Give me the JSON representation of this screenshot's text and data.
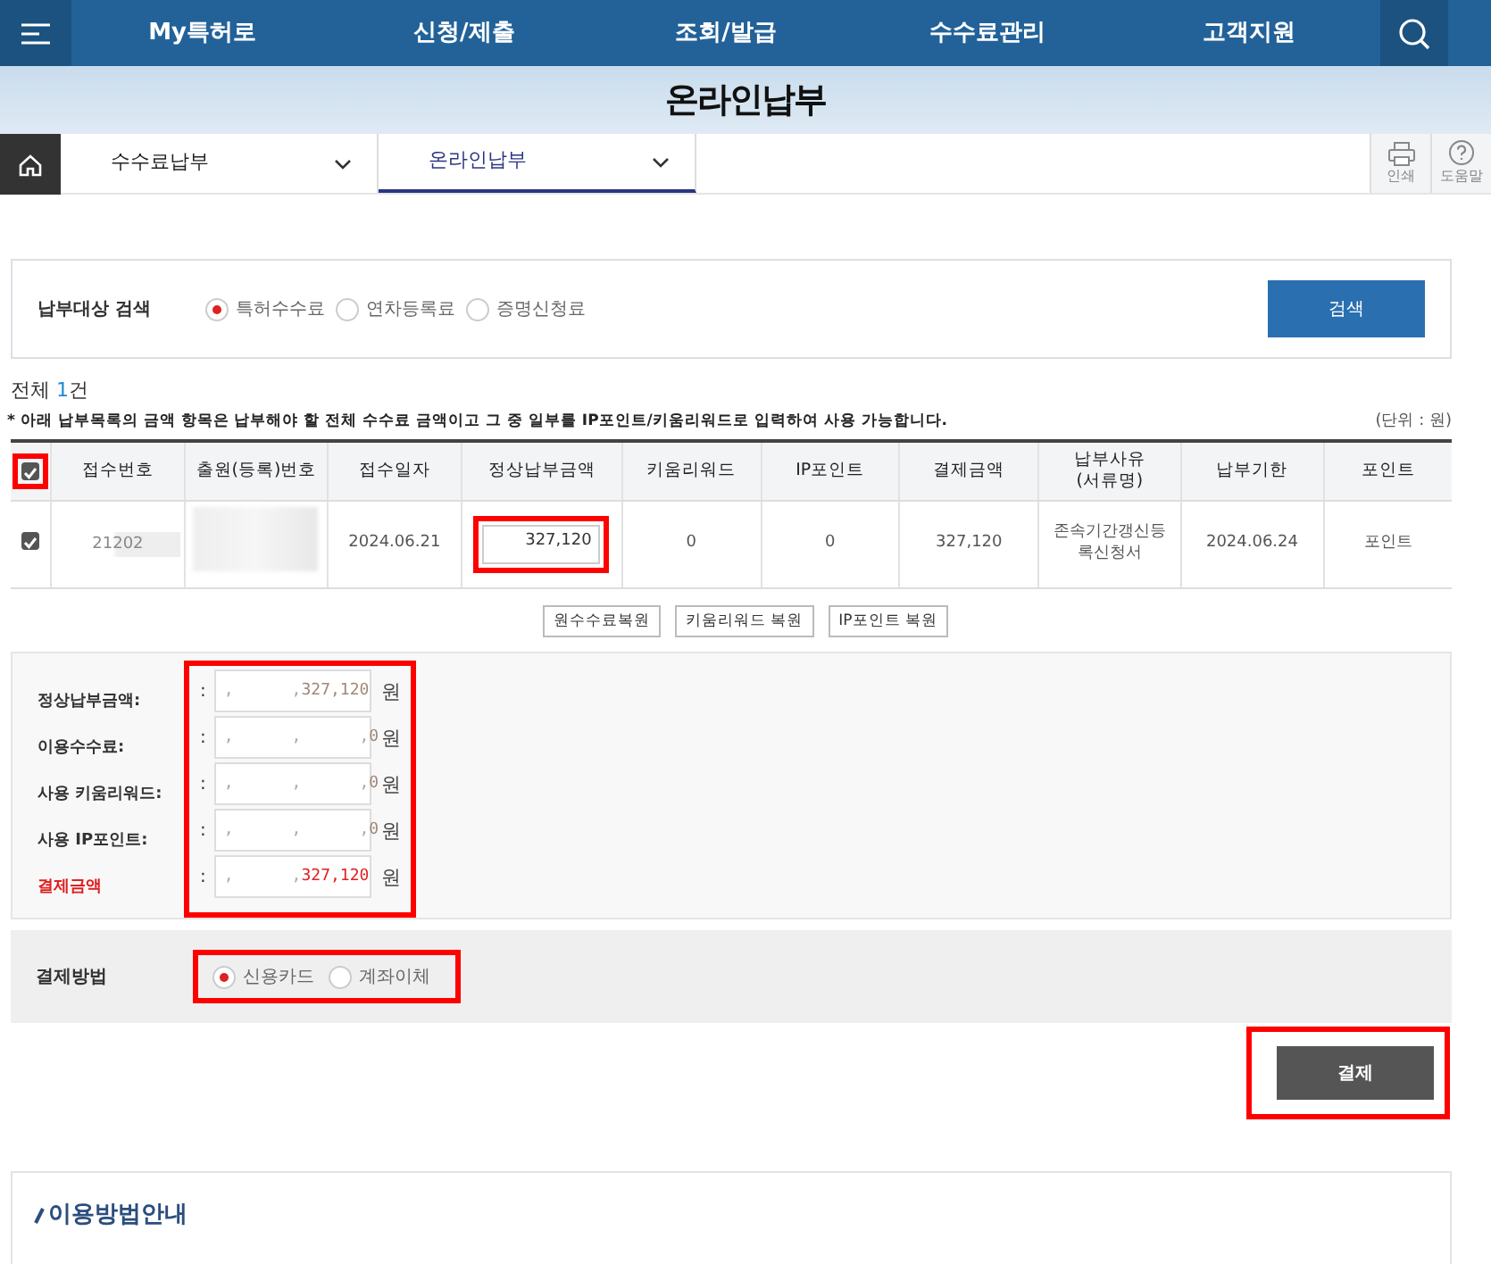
{
  "topnav": {
    "items": [
      "My특허로",
      "신청/제출",
      "조회/발급",
      "수수료관리",
      "고객지원"
    ]
  },
  "page_title": "온라인납부",
  "breadcrumb": {
    "items": [
      {
        "label": "수수료납부",
        "selected": false
      },
      {
        "label": "온라인납부",
        "selected": true
      }
    ],
    "tools": [
      {
        "kind": "print",
        "label": "인쇄"
      },
      {
        "kind": "help",
        "label": "도움말"
      }
    ]
  },
  "search": {
    "label": "납부대상 검색",
    "options": [
      {
        "label": "특허수수료",
        "selected": true
      },
      {
        "label": "연차등록료",
        "selected": false
      },
      {
        "label": "증명신청료",
        "selected": false
      }
    ],
    "button": "검색"
  },
  "total": {
    "prefix": "전체 ",
    "count": "1",
    "suffix": "건"
  },
  "note": "* 아래 납부목록의 금액 항목은 납부해야 할 전체 수수료 금액이고 그 중 일부를 IP포인트/키움리워드로 입력하여 사용 가능합니다.",
  "unit": "(단위 : 원)",
  "table": {
    "select_all": {
      "checked": true,
      "highlighted": true
    },
    "columns": [
      "접수번호",
      "출원(등록)번호",
      "접수일자",
      "정상납부금액",
      "키움리워드",
      "IP포인트",
      "결제금액",
      "납부사유\n(서류명)",
      "납부기한",
      "포인트"
    ],
    "rows": [
      {
        "checked": true,
        "cells": [
          {
            "kind": "blurred",
            "text": "21202"
          },
          {
            "kind": "blurred",
            "text": ""
          },
          {
            "kind": "text",
            "text": "2024.06.21"
          },
          {
            "kind": "input",
            "text": "327,120",
            "highlighted": true
          },
          {
            "kind": "text",
            "text": "0"
          },
          {
            "kind": "text",
            "text": "0"
          },
          {
            "kind": "text",
            "text": "327,120"
          },
          {
            "kind": "text",
            "text": "존속기간갱신등\n록신청서"
          },
          {
            "kind": "text",
            "text": "2024.06.24"
          },
          {
            "kind": "text",
            "text": "포인트"
          }
        ]
      }
    ]
  },
  "restore_buttons": [
    "원수수료복원",
    "키움리워드 복원",
    "IP포인트 복원"
  ],
  "summary": {
    "highlighted": true,
    "rows": [
      {
        "label": "정상납부금액:",
        "colon": ":",
        "prefix": ",      ,",
        "value": "327,120",
        "unit": "원",
        "emphasis": false
      },
      {
        "label": "이용수수료:",
        "colon": ":",
        "prefix": ",      ,      ,",
        "value": "0",
        "unit": "원",
        "emphasis": false
      },
      {
        "label": "사용 키움리워드:",
        "colon": ":",
        "prefix": ",      ,      ,",
        "value": "0",
        "unit": "원",
        "emphasis": false
      },
      {
        "label": "사용 IP포인트:",
        "colon": ":",
        "prefix": ",      ,      ,",
        "value": "0",
        "unit": "원",
        "emphasis": false
      },
      {
        "label": "결제금액",
        "colon": ":",
        "prefix": ",      ,",
        "value": "327,120",
        "unit": "원",
        "emphasis": true
      }
    ]
  },
  "payment": {
    "label": "결제방법",
    "highlighted": true,
    "options": [
      {
        "label": "신용카드",
        "selected": true
      },
      {
        "label": "계좌이체",
        "selected": false
      }
    ]
  },
  "pay_button": {
    "label": "결제",
    "highlighted": true
  },
  "guide": {
    "title": "이용방법안내"
  }
}
